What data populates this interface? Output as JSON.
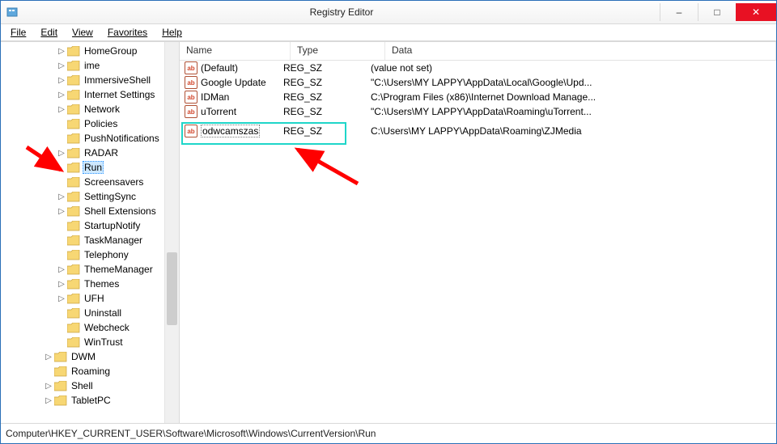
{
  "window": {
    "title": "Registry Editor"
  },
  "win_buttons": {
    "min": "–",
    "max": "□",
    "close": "✕"
  },
  "menu": [
    "File",
    "Edit",
    "View",
    "Favorites",
    "Help"
  ],
  "tree_items": [
    {
      "indent": 4,
      "glyph": "▷",
      "label": "HomeGroup"
    },
    {
      "indent": 4,
      "glyph": "▷",
      "label": "ime"
    },
    {
      "indent": 4,
      "glyph": "▷",
      "label": "ImmersiveShell"
    },
    {
      "indent": 4,
      "glyph": "▷",
      "label": "Internet Settings"
    },
    {
      "indent": 4,
      "glyph": "▷",
      "label": "Network"
    },
    {
      "indent": 4,
      "glyph": "",
      "label": "Policies"
    },
    {
      "indent": 4,
      "glyph": "",
      "label": "PushNotifications"
    },
    {
      "indent": 4,
      "glyph": "▷",
      "label": "RADAR"
    },
    {
      "indent": 4,
      "glyph": "",
      "label": "Run",
      "selected": true
    },
    {
      "indent": 4,
      "glyph": "",
      "label": "Screensavers"
    },
    {
      "indent": 4,
      "glyph": "▷",
      "label": "SettingSync"
    },
    {
      "indent": 4,
      "glyph": "▷",
      "label": "Shell Extensions"
    },
    {
      "indent": 4,
      "glyph": "",
      "label": "StartupNotify"
    },
    {
      "indent": 4,
      "glyph": "",
      "label": "TaskManager"
    },
    {
      "indent": 4,
      "glyph": "",
      "label": "Telephony"
    },
    {
      "indent": 4,
      "glyph": "▷",
      "label": "ThemeManager"
    },
    {
      "indent": 4,
      "glyph": "▷",
      "label": "Themes"
    },
    {
      "indent": 4,
      "glyph": "▷",
      "label": "UFH"
    },
    {
      "indent": 4,
      "glyph": "",
      "label": "Uninstall"
    },
    {
      "indent": 4,
      "glyph": "",
      "label": "Webcheck"
    },
    {
      "indent": 4,
      "glyph": "",
      "label": "WinTrust"
    },
    {
      "indent": 3,
      "glyph": "▷",
      "label": "DWM"
    },
    {
      "indent": 3,
      "glyph": "",
      "label": "Roaming"
    },
    {
      "indent": 3,
      "glyph": "▷",
      "label": "Shell"
    },
    {
      "indent": 3,
      "glyph": "▷",
      "label": "TabletPC"
    }
  ],
  "columns": {
    "name": "Name",
    "type": "Type",
    "data": "Data"
  },
  "rows": [
    {
      "name": "(Default)",
      "type": "REG_SZ",
      "data": "(value not set)"
    },
    {
      "name": "Google Update",
      "type": "REG_SZ",
      "data": "\"C:\\Users\\MY LAPPY\\AppData\\Local\\Google\\Upd..."
    },
    {
      "name": "IDMan",
      "type": "REG_SZ",
      "data": "C:\\Program Files (x86)\\Internet Download Manage..."
    },
    {
      "name": "uTorrent",
      "type": "REG_SZ",
      "data": "\"C:\\Users\\MY LAPPY\\AppData\\Roaming\\uTorrent..."
    },
    {
      "name": "odwcamszas",
      "type": "REG_SZ",
      "data": "C:\\Users\\MY LAPPY\\AppData\\Roaming\\ZJMedia",
      "selected": true
    }
  ],
  "statusbar": "Computer\\HKEY_CURRENT_USER\\Software\\Microsoft\\Windows\\CurrentVersion\\Run"
}
